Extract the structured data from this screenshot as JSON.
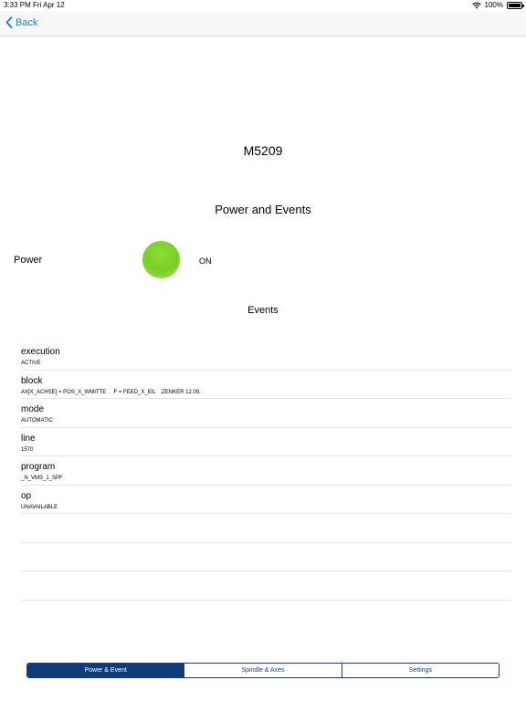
{
  "status_bar": {
    "time": "3:33 PM",
    "date": "Fri Apr 12",
    "battery": "100%"
  },
  "nav": {
    "back_label": "Back"
  },
  "machine": {
    "name": "M5209"
  },
  "section": {
    "title": "Power and Events"
  },
  "power": {
    "label": "Power",
    "value": "ON",
    "indicator_color": "#7ed321"
  },
  "events": {
    "title": "Events",
    "items": [
      {
        "name": "execution",
        "value": "ACTIVE"
      },
      {
        "name": "block",
        "value": "AX[X_ACHSE] = POS_X_WMITTE     F = FEED_X_EIL   ;ZENKER 12.09."
      },
      {
        "name": "mode",
        "value": "AUTOMATIC"
      },
      {
        "name": "line",
        "value": "1570"
      },
      {
        "name": "program",
        "value": "_N_VMS_1_SPF"
      },
      {
        "name": "op",
        "value": "UNAVAILABLE"
      },
      {
        "name": "",
        "value": ""
      },
      {
        "name": "",
        "value": ""
      },
      {
        "name": "",
        "value": ""
      }
    ]
  },
  "tabs": [
    {
      "label": "Power & Event",
      "active": true
    },
    {
      "label": "Spindle & Axes",
      "active": false
    },
    {
      "label": "Settings",
      "active": false
    }
  ],
  "colors": {
    "accent": "#1a7ef2",
    "tab_active": "#0f3b7a"
  }
}
